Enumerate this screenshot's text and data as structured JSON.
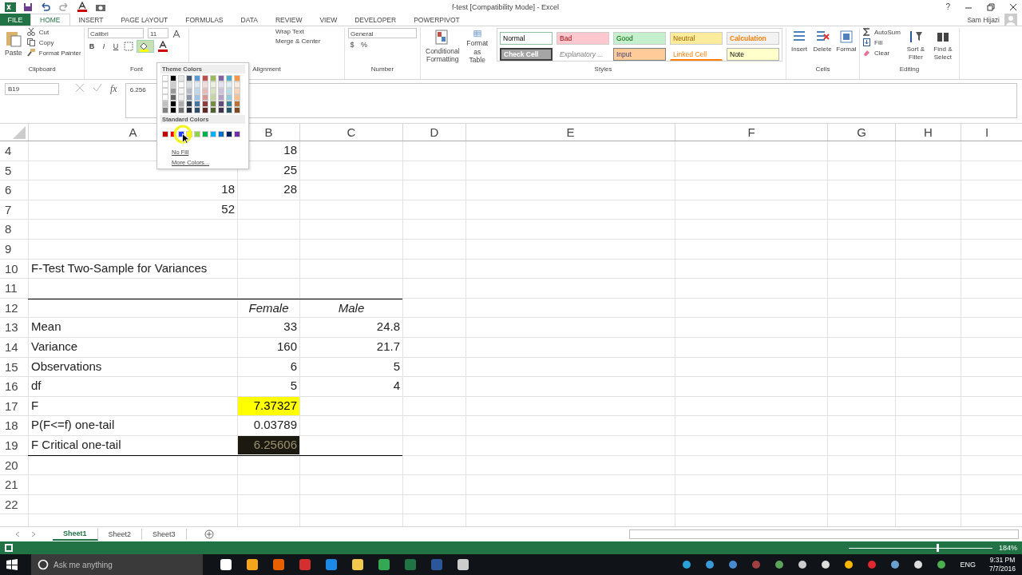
{
  "title_bar": {
    "title": "f-test  [Compatibility Mode] - Excel",
    "help": "?",
    "user": "Sam Hijazi"
  },
  "ribbon_tabs": [
    {
      "label": "FILE",
      "kind": "file",
      "selected": false
    },
    {
      "label": "HOME",
      "kind": "tab",
      "selected": true
    },
    {
      "label": "INSERT",
      "kind": "tab",
      "selected": false
    },
    {
      "label": "PAGE LAYOUT",
      "kind": "tab",
      "selected": false
    },
    {
      "label": "FORMULAS",
      "kind": "tab",
      "selected": false
    },
    {
      "label": "DATA",
      "kind": "tab",
      "selected": false
    },
    {
      "label": "REVIEW",
      "kind": "tab",
      "selected": false
    },
    {
      "label": "VIEW",
      "kind": "tab",
      "selected": false
    },
    {
      "label": "DEVELOPER",
      "kind": "tab",
      "selected": false
    },
    {
      "label": "POWERPIVOT",
      "kind": "tab",
      "selected": false
    }
  ],
  "clipboard": {
    "paste": "Paste",
    "cut": "Cut",
    "copy": "Copy",
    "format_painter": "Format Painter",
    "label": "Clipboard"
  },
  "font": {
    "name": "Calibri",
    "size": "11",
    "bold": "B",
    "italic": "I",
    "underline": "U",
    "label": "Font"
  },
  "alignment": {
    "wrap": "Wrap Text",
    "merge": "Merge & Center",
    "label": "Alignment"
  },
  "number": {
    "format": "General",
    "currency": "$",
    "percent": "%",
    "label": "Number"
  },
  "styles": {
    "conditional": "Conditional Formatting",
    "format_table": "Format as Table",
    "label": "Styles",
    "cells": [
      {
        "label": "Normal",
        "kind": "normal"
      },
      {
        "label": "Bad",
        "kind": "bad"
      },
      {
        "label": "Good",
        "kind": "good"
      },
      {
        "label": "Neutral",
        "kind": "neutral"
      },
      {
        "label": "Calculation",
        "kind": "calculation"
      },
      {
        "label": "Check Cell",
        "kind": "check"
      },
      {
        "label": "Explanatory ...",
        "kind": "explanatory"
      },
      {
        "label": "Input",
        "kind": "input"
      },
      {
        "label": "Linked Cell",
        "kind": "linked"
      },
      {
        "label": "Note",
        "kind": "note"
      }
    ]
  },
  "cells_group": {
    "insert": "Insert",
    "delete": "Delete",
    "format": "Format",
    "label": "Cells"
  },
  "editing": {
    "autosum": "AutoSum",
    "fill": "Fill",
    "clear": "Clear",
    "sort": "Sort & Filter",
    "find": "Find & Select",
    "label": "Editing"
  },
  "formula_bar": {
    "name_box": "B19",
    "fx": "fx",
    "value": "6.256"
  },
  "color_picker": {
    "theme_title": "Theme Colors",
    "standard_title": "Standard Colors",
    "no_fill": "No Fill",
    "more": "More Colors...",
    "theme": [
      {
        "color": "#ffffff"
      },
      {
        "color": "#000000"
      },
      {
        "color": "#e7e6e6"
      },
      {
        "color": "#44546a"
      },
      {
        "color": "#5b9bd5"
      },
      {
        "color": "#c0504d"
      },
      {
        "color": "#9bbb59"
      },
      {
        "color": "#8064a2"
      },
      {
        "color": "#4bacc6"
      },
      {
        "color": "#f79646"
      }
    ],
    "standard": [
      {
        "color": "#c00000"
      },
      {
        "color": "#ff0000"
      },
      {
        "color": "#1f3fff"
      },
      {
        "color": "#ffff00"
      },
      {
        "color": "#92d050"
      },
      {
        "color": "#00b050"
      },
      {
        "color": "#00b0f0"
      },
      {
        "color": "#0070c0"
      },
      {
        "color": "#002060"
      },
      {
        "color": "#7030a0"
      }
    ]
  },
  "columns": [
    "A",
    "B",
    "C",
    "D",
    "E",
    "F",
    "G",
    "H",
    "I"
  ],
  "rows": [
    {
      "number": "4",
      "b": {
        "text": "18",
        "kind": "number"
      }
    },
    {
      "number": "5",
      "b": {
        "text": "25",
        "kind": "number"
      }
    },
    {
      "number": "6",
      "a": {
        "text": "18",
        "kind": "number"
      },
      "b": {
        "text": "28",
        "kind": "number"
      }
    },
    {
      "number": "7",
      "a": {
        "text": "52",
        "kind": "number"
      }
    },
    {
      "number": "8"
    },
    {
      "number": "9"
    },
    {
      "number": "10",
      "a": {
        "text": "F-Test Two-Sample for Variances",
        "kind": "label"
      }
    },
    {
      "number": "11"
    },
    {
      "number": "12",
      "border_top": true,
      "b": {
        "text": "Female",
        "kind": "header"
      },
      "c": {
        "text": "Male",
        "kind": "header"
      }
    },
    {
      "number": "13",
      "a": {
        "text": "Mean",
        "kind": "label"
      },
      "b": {
        "text": "33",
        "kind": "number"
      },
      "c": {
        "text": "24.8",
        "kind": "number"
      }
    },
    {
      "number": "14",
      "a": {
        "text": "Variance",
        "kind": "label"
      },
      "b": {
        "text": "160",
        "kind": "number"
      },
      "c": {
        "text": "21.7",
        "kind": "number"
      }
    },
    {
      "number": "15",
      "a": {
        "text": "Observations",
        "kind": "label"
      },
      "b": {
        "text": "6",
        "kind": "number"
      },
      "c": {
        "text": "5",
        "kind": "number"
      }
    },
    {
      "number": "16",
      "a": {
        "text": "df",
        "kind": "label"
      },
      "b": {
        "text": "5",
        "kind": "number"
      },
      "c": {
        "text": "4",
        "kind": "number"
      }
    },
    {
      "number": "17",
      "a": {
        "text": "F",
        "kind": "label"
      },
      "b": {
        "text": "7.37327",
        "kind": "number",
        "color": "#ffff00"
      }
    },
    {
      "number": "18",
      "a": {
        "text": "P(F<=f) one-tail",
        "kind": "label"
      },
      "b": {
        "text": "0.03789",
        "kind": "number"
      }
    },
    {
      "number": "19",
      "border_bottom": true,
      "a": {
        "text": "F Critical one-tail",
        "kind": "label"
      },
      "b": {
        "text": "6.25606",
        "kind": "number",
        "color": "#1c1a10"
      }
    },
    {
      "number": "20"
    },
    {
      "number": "21"
    },
    {
      "number": "22"
    }
  ],
  "sheets": [
    {
      "label": "Sheet1",
      "selected": true
    },
    {
      "label": "Sheet2",
      "selected": false
    },
    {
      "label": "Sheet3",
      "selected": false
    }
  ],
  "status_bar": {
    "zoom": "184%",
    "zoom_slider": {
      "level": 0.62
    }
  },
  "taskbar": {
    "search": "Ask me anything",
    "language": "ENG",
    "time": "9:31 PM",
    "date": "7/7/2016"
  }
}
